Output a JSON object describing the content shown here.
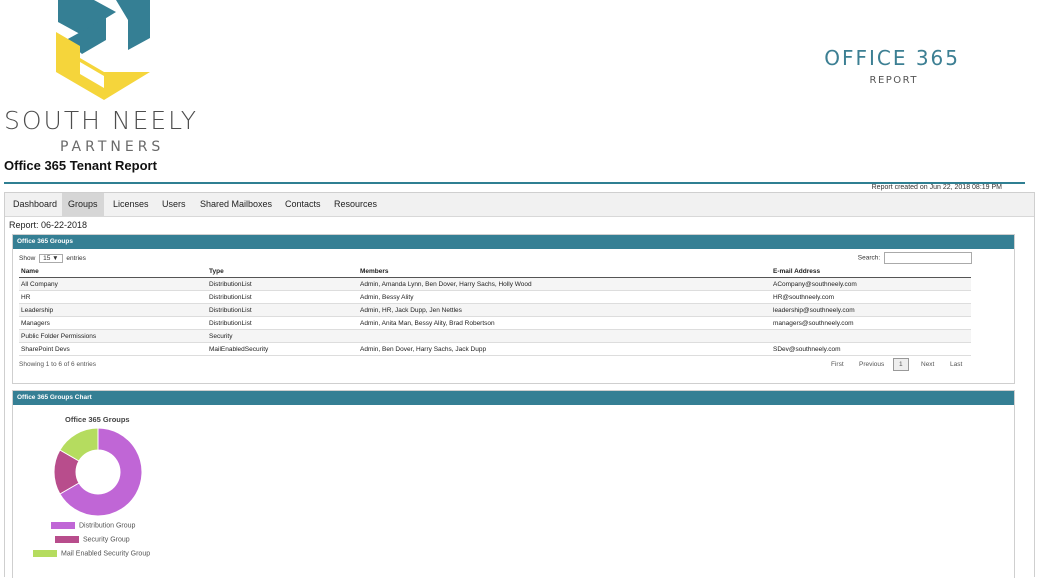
{
  "brand": {
    "name": "SOUTH NEELY",
    "subtitle": "PARTNERS",
    "page_title": "Office 365 Tenant Report",
    "header_title": "OFFICE 365",
    "header_subtitle": "REPORT",
    "created": "Report created on Jun 22, 2018 08:19 PM",
    "colors": {
      "teal": "#357f94",
      "yellow": "#f5d53b"
    }
  },
  "tabs": [
    "Dashboard",
    "Groups",
    "Licenses",
    "Users",
    "Shared Mailboxes",
    "Contacts",
    "Resources"
  ],
  "active_tab": "Groups",
  "report_date": "Report: 06-22-2018",
  "groups_panel": {
    "title": "Office 365 Groups",
    "show_label": "Show",
    "entries_value": "15",
    "entries_label": "entries",
    "search_label": "Search:",
    "columns": [
      "Name",
      "Type",
      "Members",
      "E-mail Address"
    ],
    "rows": [
      [
        "All Company",
        "DistributionList",
        "Admin, Amanda Lynn, Ben Dover, Harry Sachs, Holly Wood",
        "ACompany@southneely.com"
      ],
      [
        "HR",
        "DistributionList",
        "Admin, Bessy Ality",
        "HR@southneely.com"
      ],
      [
        "Leadership",
        "DistributionList",
        "Admin, HR, Jack Dupp, Jen Nettles",
        "leadership@southneely.com"
      ],
      [
        "Managers",
        "DistributionList",
        "Admin, Anita Man, Bessy Ality, Brad Robertson",
        "managers@southneely.com"
      ],
      [
        "Public Folder Permissions",
        "Security",
        "",
        ""
      ],
      [
        "SharePoint Devs",
        "MailEnabledSecurity",
        "Admin, Ben Dover, Harry Sachs, Jack Dupp",
        "SDev@southneely.com"
      ]
    ],
    "info": "Showing 1 to 6 of 6 entries",
    "pager": {
      "first": "First",
      "previous": "Previous",
      "current": "1",
      "next": "Next",
      "last": "Last"
    }
  },
  "chart_panel": {
    "title": "Office 365 Groups Chart"
  },
  "chart_data": {
    "type": "pie",
    "title": "Office 365 Groups",
    "donut": true,
    "legend_position": "bottom",
    "labels": [
      "Distribution Group",
      "Security Group",
      "Mail Enabled Security Group"
    ],
    "values": [
      4,
      1,
      1
    ],
    "colors": [
      "#c066d6",
      "#b84d8c",
      "#b5dc5f"
    ]
  }
}
